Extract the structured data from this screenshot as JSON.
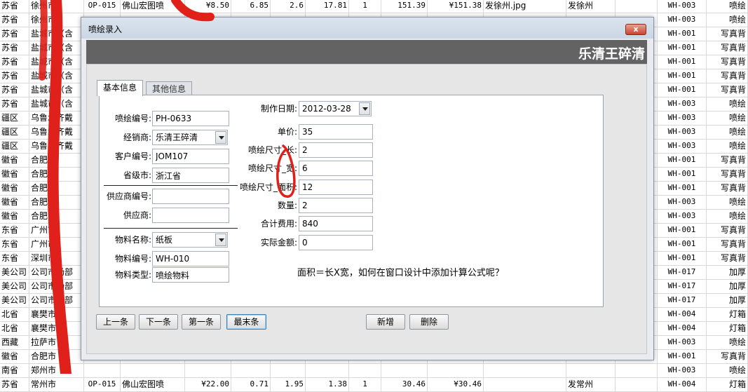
{
  "sheet": {
    "rows": [
      [
        "苏省",
        "徐州市",
        "OP-015",
        "佛山宏图喷",
        "¥8.50",
        "6.85",
        "2.6",
        "17.81",
        "1",
        "151.39",
        "¥151.38",
        "发徐州.jpg",
        "发徐州",
        "",
        "WH-003",
        "喷绘"
      ],
      [
        "苏省",
        "徐州市",
        "",
        "",
        "",
        "",
        "",
        "",
        "",
        "",
        "",
        "",
        "",
        "",
        "WH-003",
        "喷绘"
      ],
      [
        "苏省",
        "盐城市（含",
        "",
        "",
        "",
        "",
        "",
        "",
        "",
        "",
        "",
        "",
        "",
        "",
        "WH-001",
        "写真背"
      ],
      [
        "苏省",
        "盐城市（含",
        "",
        "",
        "",
        "",
        "",
        "",
        "",
        "",
        "",
        "",
        "",
        "",
        "WH-001",
        "写真背"
      ],
      [
        "苏省",
        "盐城市（含",
        "",
        "",
        "",
        "",
        "",
        "",
        "",
        "",
        "",
        "",
        "",
        "",
        "WH-001",
        "写真背"
      ],
      [
        "苏省",
        "盐城市（含",
        "",
        "",
        "",
        "",
        "",
        "",
        "",
        "",
        "",
        "",
        "",
        "",
        "WH-001",
        "写真背"
      ],
      [
        "苏省",
        "盐城市（含",
        "",
        "",
        "",
        "",
        "",
        "",
        "",
        "",
        "",
        "",
        "",
        "",
        "WH-001",
        "写真背"
      ],
      [
        "苏省",
        "盐城市（含",
        "",
        "",
        "",
        "",
        "",
        "",
        "",
        "",
        "",
        "",
        "",
        "",
        "WH-003",
        "喷绘"
      ],
      [
        "疆区",
        "乌鲁木齐戴",
        "",
        "",
        "",
        "",
        "",
        "",
        "",
        "",
        "",
        "",
        "",
        "",
        "WH-003",
        "喷绘"
      ],
      [
        "疆区",
        "乌鲁木齐戴",
        "",
        "",
        "",
        "",
        "",
        "",
        "",
        "",
        "",
        "",
        "",
        "",
        "WH-003",
        "喷绘"
      ],
      [
        "疆区",
        "乌鲁木齐戴",
        "",
        "",
        "",
        "",
        "",
        "",
        "",
        "",
        "",
        "",
        "",
        "",
        "WH-003",
        "喷绘"
      ],
      [
        "徽省",
        "合肥市",
        "",
        "",
        "",
        "",
        "",
        "",
        "",
        "",
        "",
        "",
        "",
        "",
        "WH-001",
        "写真背"
      ],
      [
        "徽省",
        "合肥市",
        "",
        "",
        "",
        "",
        "",
        "",
        "",
        "",
        "",
        "",
        "",
        "",
        "WH-001",
        "写真背"
      ],
      [
        "徽省",
        "合肥市",
        "",
        "",
        "",
        "",
        "",
        "",
        "",
        "",
        "",
        "",
        "",
        "",
        "WH-001",
        "写真背"
      ],
      [
        "徽省",
        "合肥市",
        "",
        "",
        "",
        "",
        "",
        "",
        "",
        "",
        "",
        "",
        "",
        "",
        "WH-003",
        "喷绘"
      ],
      [
        "徽省",
        "合肥市",
        "",
        "",
        "",
        "",
        "",
        "",
        "",
        "",
        "",
        "",
        "",
        "",
        "WH-003",
        "喷绘"
      ],
      [
        "东省",
        "广州市",
        "",
        "",
        "",
        "",
        "",
        "",
        "",
        "",
        "",
        "",
        "",
        "",
        "WH-001",
        "写真背"
      ],
      [
        "东省",
        "广州市",
        "",
        "",
        "",
        "",
        "",
        "",
        "",
        "",
        "",
        "",
        "",
        "",
        "WH-001",
        "写真背"
      ],
      [
        "东省",
        "深圳市",
        "",
        "",
        "",
        "",
        "",
        "",
        "",
        "",
        "",
        "",
        "",
        "",
        "WH-001",
        "写真背"
      ],
      [
        "美公司",
        "公司市场部",
        "",
        "",
        "",
        "",
        "",
        "",
        "",
        "",
        "",
        "",
        "",
        "",
        "WH-017",
        "加厚"
      ],
      [
        "美公司",
        "公司市场部",
        "",
        "",
        "",
        "",
        "",
        "",
        "",
        "",
        "",
        "",
        "",
        "",
        "WH-017",
        "加厚"
      ],
      [
        "美公司",
        "公司市场部",
        "",
        "",
        "",
        "",
        "",
        "",
        "",
        "",
        "",
        "",
        "",
        "",
        "WH-017",
        "加厚"
      ],
      [
        "北省",
        "襄樊市",
        "",
        "",
        "",
        "",
        "",
        "",
        "",
        "",
        "",
        "",
        "",
        "",
        "WH-004",
        "灯箱"
      ],
      [
        "北省",
        "襄樊市",
        "",
        "",
        "",
        "",
        "",
        "",
        "",
        "",
        "",
        "",
        "",
        "",
        "WH-004",
        "灯箱"
      ],
      [
        "西藏",
        "拉萨市",
        "",
        "",
        "",
        "",
        "",
        "",
        "",
        "",
        "",
        "",
        "",
        "",
        "WH-003",
        "喷绘"
      ],
      [
        "徽省",
        "合肥市",
        "",
        "",
        "",
        "",
        "",
        "",
        "",
        "",
        "",
        "",
        "",
        "",
        "WH-001",
        "写真背"
      ],
      [
        "南省",
        "郑州市",
        "",
        "",
        "",
        "",
        "",
        "",
        "",
        "",
        "",
        "",
        "",
        "",
        "WH-003",
        "喷绘"
      ],
      [
        "苏省",
        "常州市",
        "OP-015",
        "佛山宏图喷",
        "¥22.00",
        "0.71",
        "1.95",
        "1.38",
        "1",
        "30.46",
        "¥30.46",
        "",
        "发常州",
        "",
        "WH-004",
        "灯箱"
      ]
    ]
  },
  "dialog": {
    "title": "喷绘录入",
    "close_label": "x",
    "banner": "乐清王碎清",
    "tabs": [
      "基本信息",
      "其他信息"
    ],
    "fields": {
      "code": {
        "label": "喷绘编号:",
        "value": "PH-0633"
      },
      "dealer": {
        "label": "经销商:",
        "value": "乐清王碎清"
      },
      "customer_code": {
        "label": "客户编号:",
        "value": "JOM107"
      },
      "city": {
        "label": "省级市:",
        "value": "浙江省"
      },
      "supplier_code": {
        "label": "供应商编号:",
        "value": ""
      },
      "supplier": {
        "label": "供应商:",
        "value": ""
      },
      "material_name": {
        "label": "物料名称:",
        "value": "纸板"
      },
      "material_code": {
        "label": "物料编号:",
        "value": "WH-010"
      },
      "material_type": {
        "label": "物料类型:",
        "value": "喷绘物料"
      },
      "date": {
        "label": "制作日期:",
        "value": "2012-03-28"
      },
      "unit_price": {
        "label": "单价:",
        "value": "35"
      },
      "length": {
        "label": "喷绘尺寸_长:",
        "value": "2"
      },
      "width": {
        "label": "喷绘尺寸_宽:",
        "value": "6"
      },
      "area": {
        "label": "喷绘尺寸_面积:",
        "value": "12"
      },
      "quantity": {
        "label": "数量:",
        "value": "2"
      },
      "total": {
        "label": "合计费用:",
        "value": "840"
      },
      "actual": {
        "label": "实际金额:",
        "value": "0"
      }
    },
    "note": "面积＝长X宽，如何在窗口设计中添加计算公式呢？",
    "buttons": {
      "prev": "上一条",
      "next": "下一条",
      "first": "第一条",
      "last": "最末条",
      "add": "新增",
      "delete": "删除"
    }
  },
  "colors": {
    "banner": "#636363",
    "annotation": "#e0201a"
  }
}
